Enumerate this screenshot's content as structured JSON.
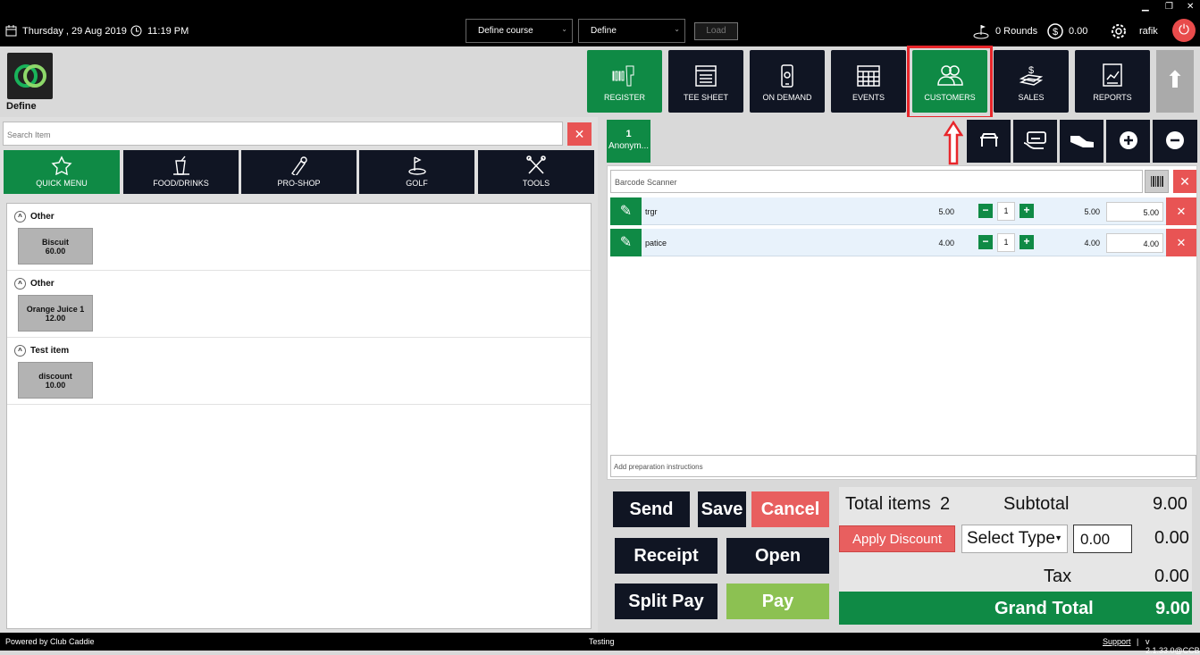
{
  "topbar": {
    "date": "Thursday ,  29 Aug 2019",
    "time": "11:19 PM",
    "course_select": "Define course",
    "define_select": "Define",
    "load_label": "Load",
    "rounds": "0 Rounds",
    "balance": "0.00",
    "user": "rafik"
  },
  "brand": {
    "name": "Define"
  },
  "nav": [
    {
      "label": "REGISTER",
      "icon": "barcode-scanner-icon"
    },
    {
      "label": "TEE SHEET",
      "icon": "calendar-list-icon"
    },
    {
      "label": "ON DEMAND",
      "icon": "mobile-phone-icon"
    },
    {
      "label": "EVENTS",
      "icon": "calendar-grid-icon"
    },
    {
      "label": "CUSTOMERS",
      "icon": "users-icon"
    },
    {
      "label": "SALES",
      "icon": "money-icon"
    },
    {
      "label": "REPORTS",
      "icon": "report-chart-icon"
    }
  ],
  "search": {
    "placeholder": "Search Item"
  },
  "categories": [
    {
      "label": "QUICK MENU",
      "icon": "star-icon"
    },
    {
      "label": "FOOD/DRINKS",
      "icon": "drink-icon"
    },
    {
      "label": "PRO-SHOP",
      "icon": "pro-shop-icon"
    },
    {
      "label": "GOLF",
      "icon": "golf-icon"
    },
    {
      "label": "TOOLS",
      "icon": "tools-icon"
    }
  ],
  "groups": [
    {
      "name": "Other",
      "item": {
        "name": "Biscuit",
        "price": "60.00"
      }
    },
    {
      "name": "Other",
      "item": {
        "name": "Orange Juice 1",
        "price": "12.00"
      }
    },
    {
      "name": "Test item",
      "item": {
        "name": "discount",
        "price": "10.00"
      }
    }
  ],
  "customer_tab": {
    "number": "1",
    "name": "Anonym..."
  },
  "barcode": {
    "placeholder": "Barcode Scanner"
  },
  "cart": [
    {
      "name": "trgr",
      "price": "5.00",
      "qty": "1",
      "total": "5.00",
      "amount": "5.00"
    },
    {
      "name": "patice",
      "price": "4.00",
      "qty": "1",
      "total": "4.00",
      "amount": "4.00"
    }
  ],
  "prep": {
    "placeholder": "Add preparation instructions"
  },
  "actions": {
    "send": "Send",
    "save": "Save",
    "cancel": "Cancel",
    "receipt": "Receipt",
    "open": "Open",
    "split_pay": "Split Pay",
    "pay": "Pay"
  },
  "totals": {
    "total_items_label": "Total items",
    "total_items": "2",
    "subtotal_label": "Subtotal",
    "subtotal": "9.00",
    "apply_discount": "Apply Discount",
    "select_type": "Select Type",
    "discount_input": "0.00",
    "discount_value": "0.00",
    "tax_label": "Tax",
    "tax": "0.00",
    "grand_total_label": "Grand Total",
    "grand_total": "9.00"
  },
  "footer": {
    "powered": "Powered by Club Caddie",
    "env": "Testing",
    "support": "Support",
    "version": "v 2.1.33.0@CCB"
  },
  "colors": {
    "green": "#0f8a45",
    "dark": "#101523",
    "red": "#e85454",
    "highlight": "#e8262b"
  }
}
